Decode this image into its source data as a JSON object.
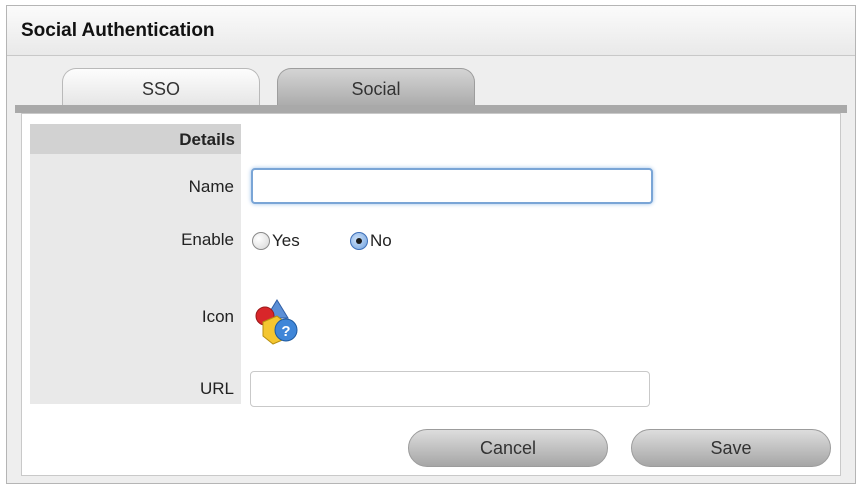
{
  "window": {
    "title": "Social Authentication"
  },
  "tabs": [
    {
      "label": "SSO",
      "active": false
    },
    {
      "label": "Social",
      "active": true
    }
  ],
  "form": {
    "section_header": "Details",
    "name": {
      "label": "Name",
      "value": ""
    },
    "enable": {
      "label": "Enable",
      "options": [
        {
          "label": "Yes",
          "checked": false
        },
        {
          "label": "No",
          "checked": true
        }
      ]
    },
    "icon": {
      "label": "Icon",
      "icon_name": "shapes-help-icon"
    },
    "url": {
      "label": "URL",
      "value": ""
    }
  },
  "buttons": {
    "cancel": "Cancel",
    "save": "Save"
  },
  "colors": {
    "focus_border": "#7aa5d6",
    "radio_selected": "#6e9fdc"
  }
}
